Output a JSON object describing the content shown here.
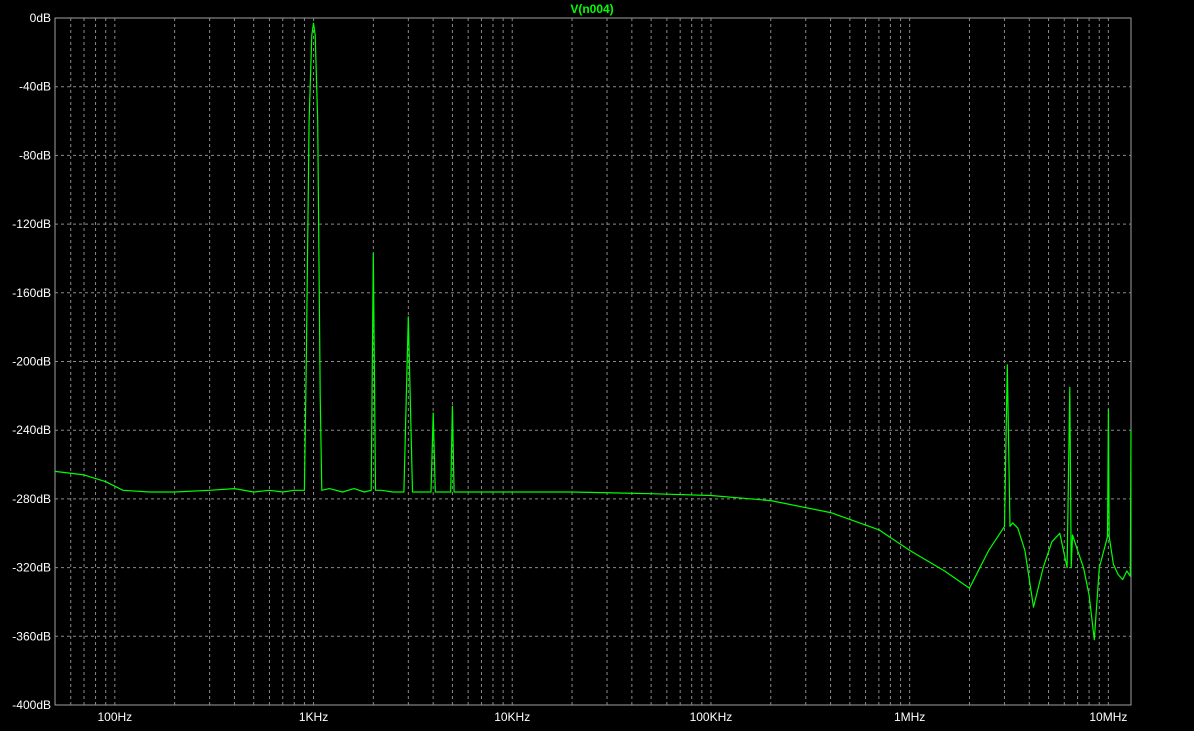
{
  "chart_data": {
    "type": "line",
    "title": "V(n004)",
    "x_scale": "log",
    "xlim": [
      50,
      13000000
    ],
    "ylim": [
      -400,
      0
    ],
    "x_unit": "Hz",
    "y_unit": "dB",
    "grid": true,
    "x_ticks": [
      {
        "value": 100,
        "label": "100Hz"
      },
      {
        "value": 1000,
        "label": "1KHz"
      },
      {
        "value": 10000,
        "label": "10KHz"
      },
      {
        "value": 100000,
        "label": "100KHz"
      },
      {
        "value": 1000000,
        "label": "1MHz"
      },
      {
        "value": 10000000,
        "label": "10MHz"
      }
    ],
    "y_ticks": [
      {
        "value": 0,
        "label": "0dB"
      },
      {
        "value": -40,
        "label": "-40dB"
      },
      {
        "value": -80,
        "label": "-80dB"
      },
      {
        "value": -120,
        "label": "-120dB"
      },
      {
        "value": -160,
        "label": "-160dB"
      },
      {
        "value": -200,
        "label": "-200dB"
      },
      {
        "value": -240,
        "label": "-240dB"
      },
      {
        "value": -280,
        "label": "-280dB"
      },
      {
        "value": -320,
        "label": "-320dB"
      },
      {
        "value": -360,
        "label": "-360dB"
      },
      {
        "value": -400,
        "label": "-400dB"
      }
    ],
    "series": [
      {
        "name": "V(n004)",
        "color": "#00ff00",
        "x": [
          50,
          70,
          90,
          110,
          150,
          200,
          300,
          400,
          500,
          600,
          700,
          800,
          900,
          920,
          950,
          980,
          1000,
          1020,
          1050,
          1080,
          1100,
          1200,
          1400,
          1600,
          1800,
          1950,
          2000,
          2050,
          2200,
          2500,
          2850,
          3000,
          3150,
          3500,
          3900,
          4000,
          4100,
          4500,
          4900,
          5000,
          5100,
          6000,
          8000,
          10000,
          20000,
          50000,
          100000,
          200000,
          400000,
          700000,
          1000000,
          1500000,
          2000000,
          2500000,
          3000000,
          3100000,
          3200000,
          3300000,
          3500000,
          3800000,
          4200000,
          4700000,
          5200000,
          5700000,
          6200000,
          6400000,
          6500000,
          6600000,
          7000000,
          7500000,
          8000000,
          8500000,
          9000000,
          9500000,
          9900000,
          10000000,
          10100000,
          10600000,
          11200000,
          11800000,
          12400000,
          12900000,
          13000000
        ],
        "y": [
          -264,
          -266,
          -270,
          -275,
          -276,
          -276,
          -275,
          -274,
          -276,
          -275,
          -276,
          -275,
          -275,
          -200,
          -60,
          -10,
          -3,
          -10,
          -60,
          -220,
          -275,
          -274,
          -276,
          -274,
          -276,
          -275,
          -137,
          -275,
          -275,
          -276,
          -276,
          -174,
          -276,
          -276,
          -276,
          -230,
          -276,
          -276,
          -276,
          -226,
          -276,
          -276,
          -276,
          -276,
          -276,
          -277,
          -278,
          -281,
          -288,
          -298,
          -310,
          -322,
          -332,
          -310,
          -296,
          -202,
          -296,
          -294,
          -297,
          -310,
          -343,
          -320,
          -305,
          -300,
          -320,
          -215,
          -320,
          -301,
          -310,
          -320,
          -336,
          -362,
          -320,
          -310,
          -302,
          -228,
          -302,
          -318,
          -324,
          -327,
          -322,
          -325,
          -240
        ]
      }
    ]
  }
}
